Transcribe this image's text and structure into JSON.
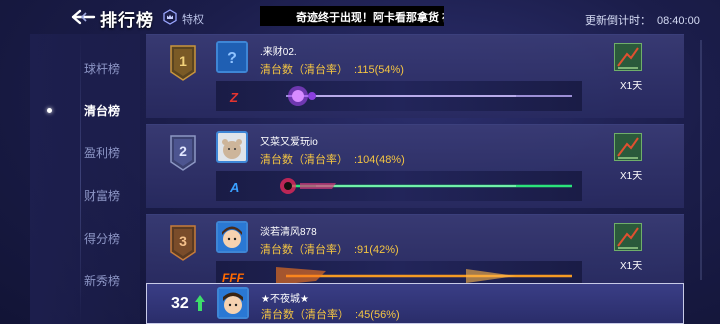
{
  "header": {
    "title": "排行榜",
    "privilege_label": "特权",
    "ticker_text": "奇迹终于出现！阿卡看那拿货 在",
    "countdown_label": "更新倒计时：",
    "countdown_value": "08:40:00"
  },
  "sidebar": {
    "items": [
      {
        "label": "球杆榜",
        "active": false
      },
      {
        "label": "清台榜",
        "active": true
      },
      {
        "label": "盈利榜",
        "active": false
      },
      {
        "label": "财富榜",
        "active": false
      },
      {
        "label": "得分榜",
        "active": false
      },
      {
        "label": "新秀榜",
        "active": false
      }
    ]
  },
  "stat_label": "清台数（清台率）",
  "rankings": [
    {
      "rank": "1",
      "name": ".来财02.",
      "stat_value": ":115(54%)",
      "reward_label": "X1天",
      "badge_color": "#c9953d",
      "cue_color": "#b14cff",
      "cue_logo": "Z",
      "cue_logo_color": "#e3342f"
    },
    {
      "rank": "2",
      "name": "又菜又爱玩io",
      "stat_value": ":104(48%)",
      "reward_label": "X1天",
      "badge_color": "#8d97c4",
      "cue_color": "#2be37a",
      "cue_logo": "A",
      "cue_logo_color": "#3aa0ff"
    },
    {
      "rank": "3",
      "name": "淡若清风878",
      "stat_value": ":91(42%)",
      "reward_label": "X1天",
      "badge_color": "#c77c3a",
      "cue_color": "#f59a23",
      "cue_logo": "FFF",
      "cue_logo_color": "#ff6a00"
    }
  ],
  "me": {
    "rank": "32",
    "name": "★不夜城★",
    "stat_value": ":45(56%)"
  }
}
